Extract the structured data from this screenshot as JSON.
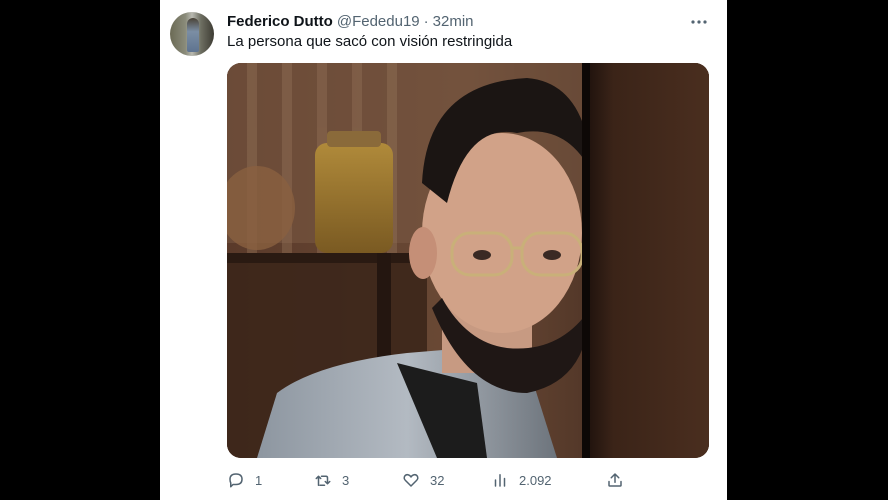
{
  "tweet": {
    "author_name": "Federico Dutto",
    "handle": "@Fededu19",
    "separator": "·",
    "time": "32min",
    "text": "La persona que sacó con visión restringida"
  },
  "actions": {
    "reply_count": "1",
    "retweet_count": "3",
    "like_count": "32",
    "view_count": "2.092"
  },
  "icons": {
    "more": "more-horizontal-icon",
    "reply": "reply-icon",
    "retweet": "retweet-icon",
    "like": "heart-icon",
    "views": "bar-chart-icon",
    "share": "share-icon"
  },
  "colors": {
    "text_primary": "#0f1419",
    "text_secondary": "#536471",
    "page_background": "#000000",
    "card_background": "#ffffff"
  }
}
